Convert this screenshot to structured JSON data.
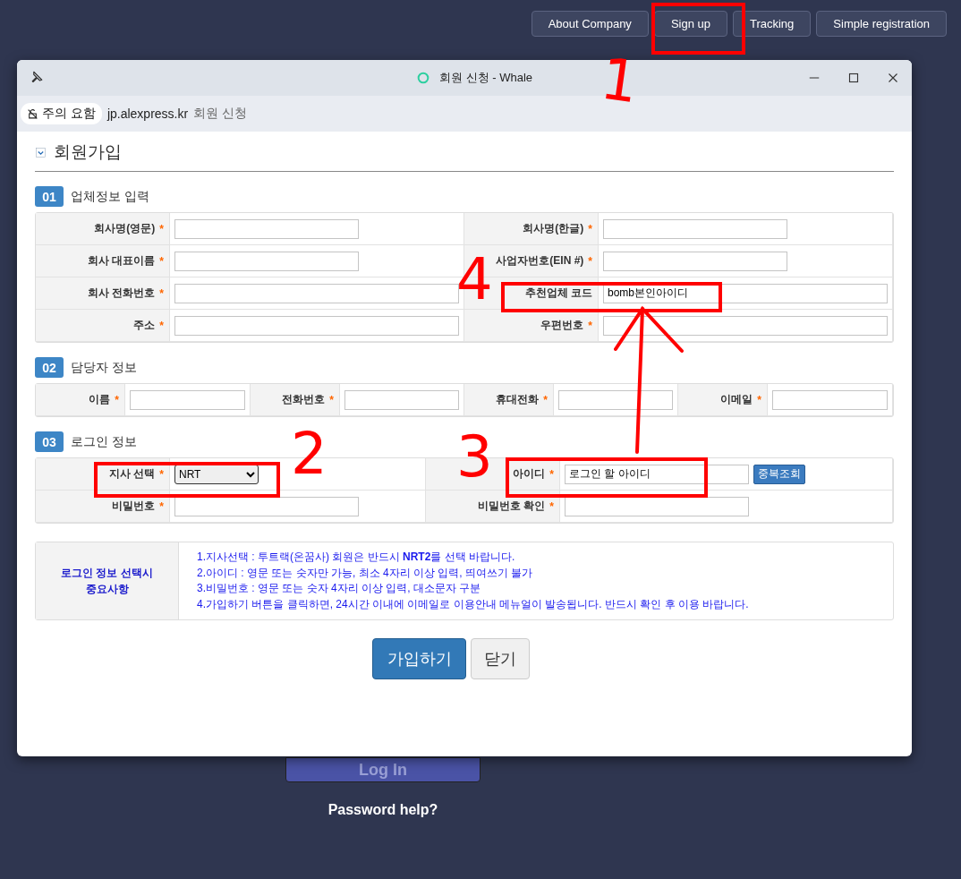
{
  "top_nav": [
    {
      "label": "About Company"
    },
    {
      "label": "Sign up"
    },
    {
      "label": "Tracking"
    },
    {
      "label": "Simple registration"
    }
  ],
  "background_page": {
    "login_button": "Log In",
    "password_help": "Password help?"
  },
  "window": {
    "title": "회원 신청 - Whale",
    "security_badge": "주의 요함",
    "url": "jp.alexpress.kr",
    "page_title": "회원 신청"
  },
  "heading": "회원가입",
  "sections": [
    {
      "number": "01",
      "title": "업체정보 입력",
      "kind": "two_col",
      "fields": [
        {
          "label": "회사명(영문)",
          "mark": "*",
          "kind": "short_text"
        },
        {
          "label": "회사명(한글)",
          "mark": "*",
          "kind": "short_text"
        },
        {
          "label": "회사 대표이름",
          "mark": "*",
          "kind": "short_text"
        },
        {
          "label": "사업자번호(EIN #)",
          "mark": "*",
          "kind": "short_text"
        },
        {
          "label": "회사 전화번호",
          "mark": "*",
          "kind": "long_text"
        },
        {
          "label": "추천업체 코드",
          "kind": "long_text",
          "value": "bomb본인아이디"
        },
        {
          "label": "주소",
          "mark": "*",
          "kind": "long_text"
        },
        {
          "label": "우편번호",
          "mark": "*",
          "kind": "long_text"
        }
      ]
    },
    {
      "number": "02",
      "title": "담당자 정보",
      "kind": "four_col",
      "fields": [
        {
          "label": "이름",
          "mark": "*",
          "kind": "long_text"
        },
        {
          "label": "전화번호",
          "mark": "*",
          "kind": "long_text"
        },
        {
          "label": "휴대전화",
          "mark": "*",
          "kind": "long_text"
        },
        {
          "label": "이메일",
          "mark": "*",
          "kind": "long_text"
        }
      ]
    },
    {
      "number": "03",
      "title": "로그인 정보",
      "kind": "two_col_wide",
      "fields": [
        {
          "label": "지사 선택",
          "mark": "*",
          "kind": "select",
          "value": "NRT"
        },
        {
          "label": "아이디",
          "mark": "*",
          "kind": "short_text_button",
          "value": "로그인 할 아이디",
          "button": "중복조회"
        },
        {
          "label": "비밀번호",
          "mark": "*",
          "kind": "short_text"
        },
        {
          "label": "비밀번호 확인",
          "mark": "*",
          "kind": "short_text"
        }
      ]
    }
  ],
  "notes": {
    "title": "로그인 정보 선택시 중요사항",
    "lines": [
      "1.지사선택 : 투트랙(온꿈사) 회원은 반드시 **NRT2**를 선택 바랍니다.",
      "2.아이디 : 영문 또는 숫자만 가능, 최소 4자리 이상 입력, 띄여쓰기 불가",
      "3.비밀번호 : 영문 또는 숫자 4자리 이상 입력, 대소문자 구분",
      "4.가입하기 버튼을 클릭하면, 24시간 이내에 이메일로 이용안내 메뉴얼이 발송됩니다. 반드시 확인 후 이용 바랍니다."
    ]
  },
  "buttons": [
    {
      "label": "가입하기",
      "kind": "primary"
    },
    {
      "label": "닫기",
      "kind": "default"
    }
  ],
  "annotations": [
    {
      "label": "1"
    },
    {
      "label": "2"
    },
    {
      "label": "3"
    },
    {
      "label": "4"
    }
  ]
}
